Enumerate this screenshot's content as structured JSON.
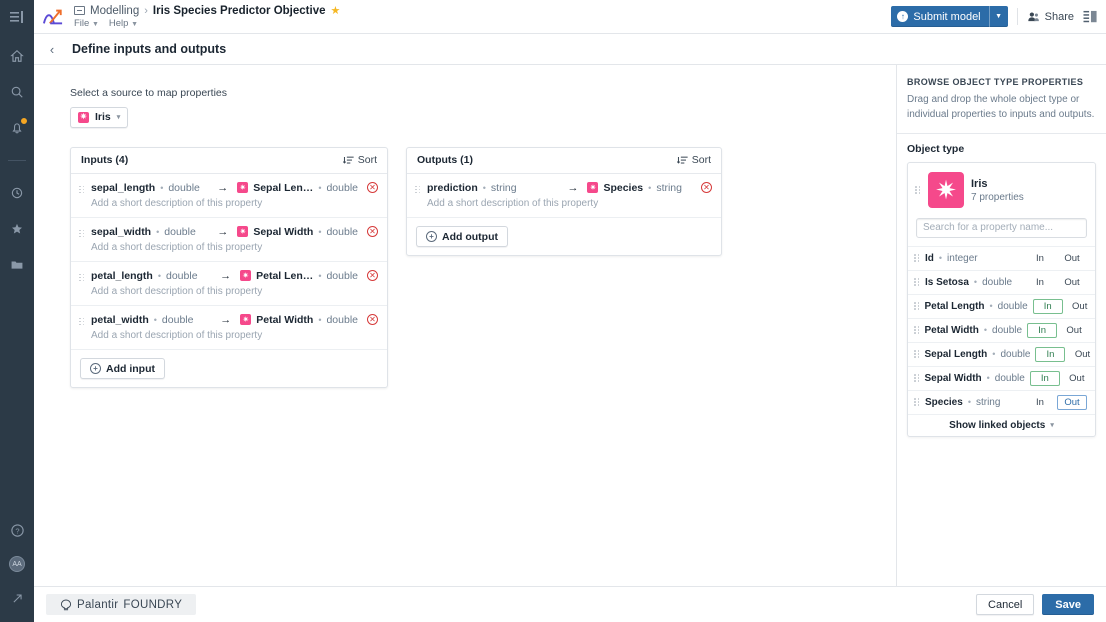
{
  "rail": {
    "toggle_icon": "sidebar-toggle-icon",
    "items": [
      {
        "name": "home-icon",
        "glyph": "⌂"
      },
      {
        "name": "search-icon",
        "glyph": "⚲"
      },
      {
        "name": "notifications-icon",
        "glyph": "⚑",
        "badge": true
      }
    ],
    "items2": [
      {
        "name": "recent-icon",
        "glyph": "◷"
      },
      {
        "name": "favorites-icon",
        "glyph": "★"
      },
      {
        "name": "files-icon",
        "glyph": "▰"
      }
    ],
    "bottom": [
      {
        "name": "help-icon",
        "glyph": "?"
      },
      {
        "name": "user-avatar",
        "glyph": "AA"
      },
      {
        "name": "external-link-icon",
        "glyph": "↗"
      }
    ]
  },
  "header": {
    "logo": "foundry-modelling-logo",
    "breadcrumb_root": "Modelling",
    "breadcrumb_sep": "›",
    "breadcrumb_title": "Iris Species Predictor Objective",
    "star": "★",
    "menus": [
      "File",
      "Help"
    ],
    "submit_label": "Submit model",
    "share_label": "Share",
    "panel_toggle": "layout-panel-icon"
  },
  "page": {
    "back": "‹",
    "title": "Define inputs and outputs"
  },
  "source": {
    "label": "Select a source to map properties",
    "value": "Iris",
    "caret": "▾"
  },
  "inputs_card": {
    "title": "Inputs (4)",
    "sort_label": "Sort",
    "add_label": "Add input",
    "rows": [
      {
        "name": "sepal_length",
        "type": "double",
        "desc": "Add a short description of this property",
        "target": "Sepal Len…",
        "target_type": "double"
      },
      {
        "name": "sepal_width",
        "type": "double",
        "desc": "Add a short description of this property",
        "target": "Sepal Width",
        "target_type": "double"
      },
      {
        "name": "petal_length",
        "type": "double",
        "desc": "Add a short description of this property",
        "target": "Petal Len…",
        "target_type": "double"
      },
      {
        "name": "petal_width",
        "type": "double",
        "desc": "Add a short description of this property",
        "target": "Petal Width",
        "target_type": "double"
      }
    ]
  },
  "outputs_card": {
    "title": "Outputs (1)",
    "sort_label": "Sort",
    "add_label": "Add output",
    "rows": [
      {
        "name": "prediction",
        "type": "string",
        "desc": "Add a short description of this property",
        "target": "Species",
        "target_type": "string"
      }
    ]
  },
  "right_panel": {
    "kicker": "BROWSE OBJECT TYPE PROPERTIES",
    "sub": "Drag and drop the whole object type or individual properties to inputs and outputs.",
    "section_title": "Object type",
    "object_name": "Iris",
    "object_count": "7 properties",
    "search_placeholder": "Search for a property name...",
    "search_value": "",
    "in_label": "In",
    "out_label": "Out",
    "properties": [
      {
        "name": "Id",
        "type": "integer",
        "in": false,
        "out": false
      },
      {
        "name": "Is Setosa",
        "type": "double",
        "in": false,
        "out": false
      },
      {
        "name": "Petal Length",
        "type": "double",
        "in": true,
        "out": false
      },
      {
        "name": "Petal Width",
        "type": "double",
        "in": true,
        "out": false
      },
      {
        "name": "Sepal Length",
        "type": "double",
        "in": true,
        "out": false
      },
      {
        "name": "Sepal Width",
        "type": "double",
        "in": true,
        "out": false
      },
      {
        "name": "Species",
        "type": "string",
        "in": false,
        "out": true
      }
    ],
    "show_linked": "Show linked objects",
    "show_linked_caret": "▾"
  },
  "footer": {
    "brand_mark": "Palantir",
    "brand_name": "FOUNDRY",
    "cancel_label": "Cancel",
    "save_label": "Save"
  },
  "colors": {
    "accent_blue": "#2c6ca8",
    "object_pink": "#f5498b",
    "rail_dark": "#2c3a47",
    "danger_red": "#d63a3a",
    "in_green": "#2f7d4f",
    "star_gold": "#f5b722"
  }
}
